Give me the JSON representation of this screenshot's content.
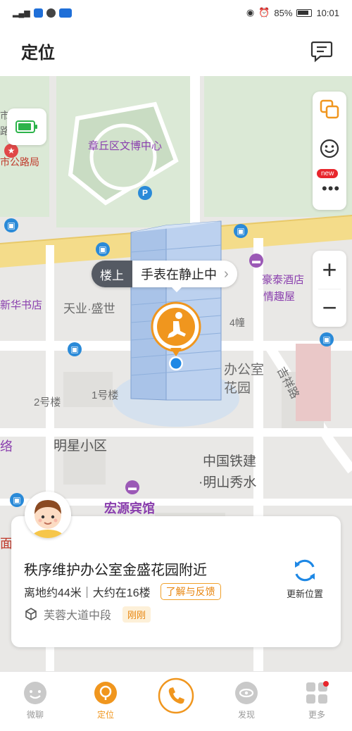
{
  "status_bar": {
    "battery": "85%",
    "time": "10:01"
  },
  "header": {
    "title": "定位"
  },
  "map_labels": {
    "cultural_center": "章丘区文博中心",
    "bureau": "市公路局",
    "bureau_partial": "市公",
    "bureau_partial2": "路局",
    "xinhua": "新华书店",
    "tianye": "天业·盛世",
    "haotai_hotel": "豪泰酒店",
    "qingqu": "情趣屋",
    "building4": "4幢",
    "office": "办公室",
    "garden": "花园",
    "building2": "2号楼",
    "building1": "1号楼",
    "mingxing": "明星小区",
    "railway1": "中国铁建",
    "railway2": "·明山秀水",
    "hongyuan": "宏源宾馆",
    "jixiang": "吉祥路",
    "luo": "络",
    "mian": "面"
  },
  "bubble": {
    "floor_tag": "楼上",
    "status_text": "手表在静止中",
    "chevron": "›"
  },
  "tools": {
    "new_badge": "new",
    "more": "•••"
  },
  "zoom": {
    "in": "+",
    "out": "−"
  },
  "info": {
    "address": "秩序维护办公室金盛花园附近",
    "height_text": "离地约44米｜大约在16楼",
    "feedback": "了解与反馈",
    "road": "芙蓉大道中段",
    "time_ago": "刚刚",
    "refresh_label": "更新位置"
  },
  "nav": [
    {
      "label": "微聊"
    },
    {
      "label": "定位"
    },
    {
      "label": ""
    },
    {
      "label": "发现"
    },
    {
      "label": "更多"
    }
  ],
  "colors": {
    "accent": "#f0961e",
    "blue": "#1e88e5",
    "purple": "#8a3fae"
  }
}
